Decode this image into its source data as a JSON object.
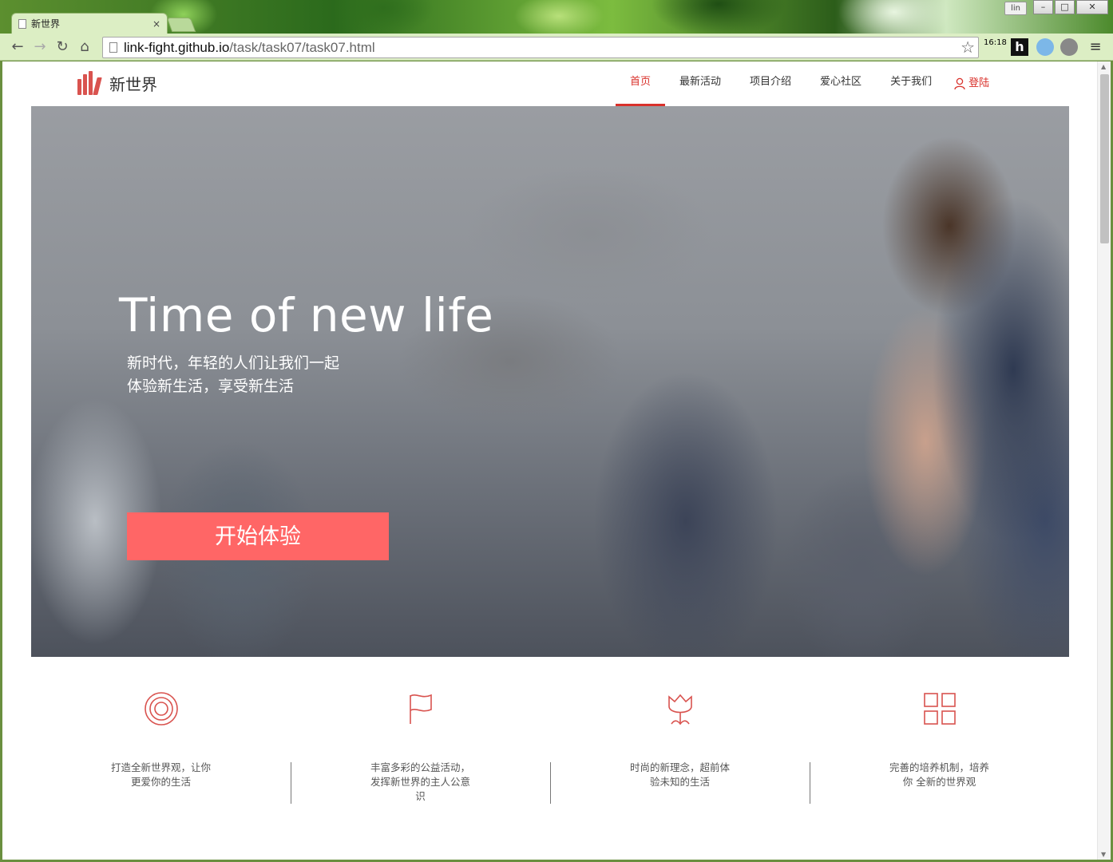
{
  "browser": {
    "tab_title": "新世界",
    "tab_close": "×",
    "user_badge": "lin",
    "url_host": "link-fight.github.io",
    "url_path": "/task/task07/task07.html",
    "clock": "16:18"
  },
  "site": {
    "logo_text": "新世界",
    "nav": [
      "首页",
      "最新活动",
      "项目介绍",
      "爱心社区",
      "关于我们"
    ],
    "login_label": "登陆",
    "accent_color": "#d9312b"
  },
  "hero": {
    "title": "Time of new life",
    "subtitle_line1": "新时代，年轻的人们让我们一起",
    "subtitle_line2": "体验新生活，享受新生活",
    "cta_label": "开始体验",
    "cta_color": "#ff6666"
  },
  "features": [
    {
      "icon": "target-icon",
      "text": "打造全新世界观，让你更爱你的生活"
    },
    {
      "icon": "flag-icon",
      "text": "丰富多彩的公益活动，发挥新世界的主人公意识"
    },
    {
      "icon": "tulip-icon",
      "text": "时尚的新理念，超前体验未知的生活"
    },
    {
      "icon": "grid-icon",
      "text": "完善的培养机制，培养你 全新的世界观"
    }
  ]
}
